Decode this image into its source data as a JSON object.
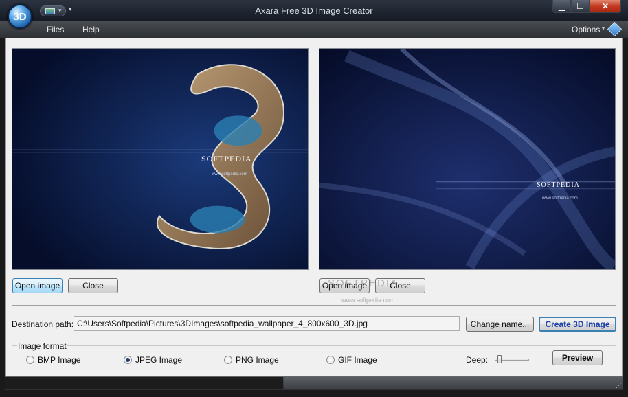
{
  "window": {
    "title": "Axara Free 3D Image Creator",
    "app_icon_text": "3D",
    "minimize_glyph": "▁",
    "maximize_glyph": "☐",
    "close_glyph": "✕"
  },
  "menu": {
    "files": "Files",
    "help": "Help",
    "options": "Options"
  },
  "left_pane": {
    "image_caption": "SOFTPEDIA",
    "image_url": "www.softpedia.com",
    "open_label": "Open image",
    "close_label": "Close"
  },
  "right_pane": {
    "image_caption": "SOFTPEDIA",
    "image_url": "www.softpedia.com",
    "open_label": "Open image",
    "close_label": "Close"
  },
  "destination": {
    "label": "Destination path:",
    "value": "C:\\Users\\Softpedia\\Pictures\\3DImages\\softpedia_wallpaper_4_800x600_3D.jpg",
    "change_name_label": "Change name...",
    "create_label": "Create 3D Image"
  },
  "image_format": {
    "group_label": "Image format",
    "options": [
      "BMP Image",
      "JPEG Image",
      "PNG Image",
      "GIF Image"
    ],
    "selected": "JPEG Image"
  },
  "deep": {
    "label": "Deep:",
    "level": 0.1
  },
  "preview_label": "Preview",
  "watermark": {
    "main": "SOFTPEDIA",
    "sub": "www.softpedia.com"
  },
  "colors": {
    "ribbon": "#3a3d42",
    "client": "#f0f0f0",
    "create_text": "#1a3fa8"
  }
}
